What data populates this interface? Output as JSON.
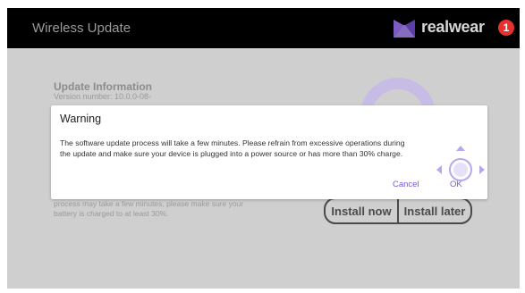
{
  "header": {
    "title": "Wireless Update",
    "brand": "realwear",
    "notification_count": "1"
  },
  "background": {
    "title": "Update Information",
    "version": "Version number: 10.0.0-08-",
    "version_cont": "...",
    "note": "process may take a few minutes, please make sure your battery is charged to at least 30%.",
    "install_now": "Install now",
    "install_later": "Install later"
  },
  "dialog": {
    "title": "Warning",
    "message_line1": "The software update process will take a few minutes. Please refrain from excessive operations during",
    "message_line2": "the update and make sure your device is plugged into a power source or has more than 30% charge.",
    "cancel": "Cancel",
    "ok": "OK"
  },
  "colors": {
    "accent": "#7b57d9",
    "badge": "#e6312f",
    "topbar": "#000000",
    "overlay": "#cfcfcf"
  }
}
